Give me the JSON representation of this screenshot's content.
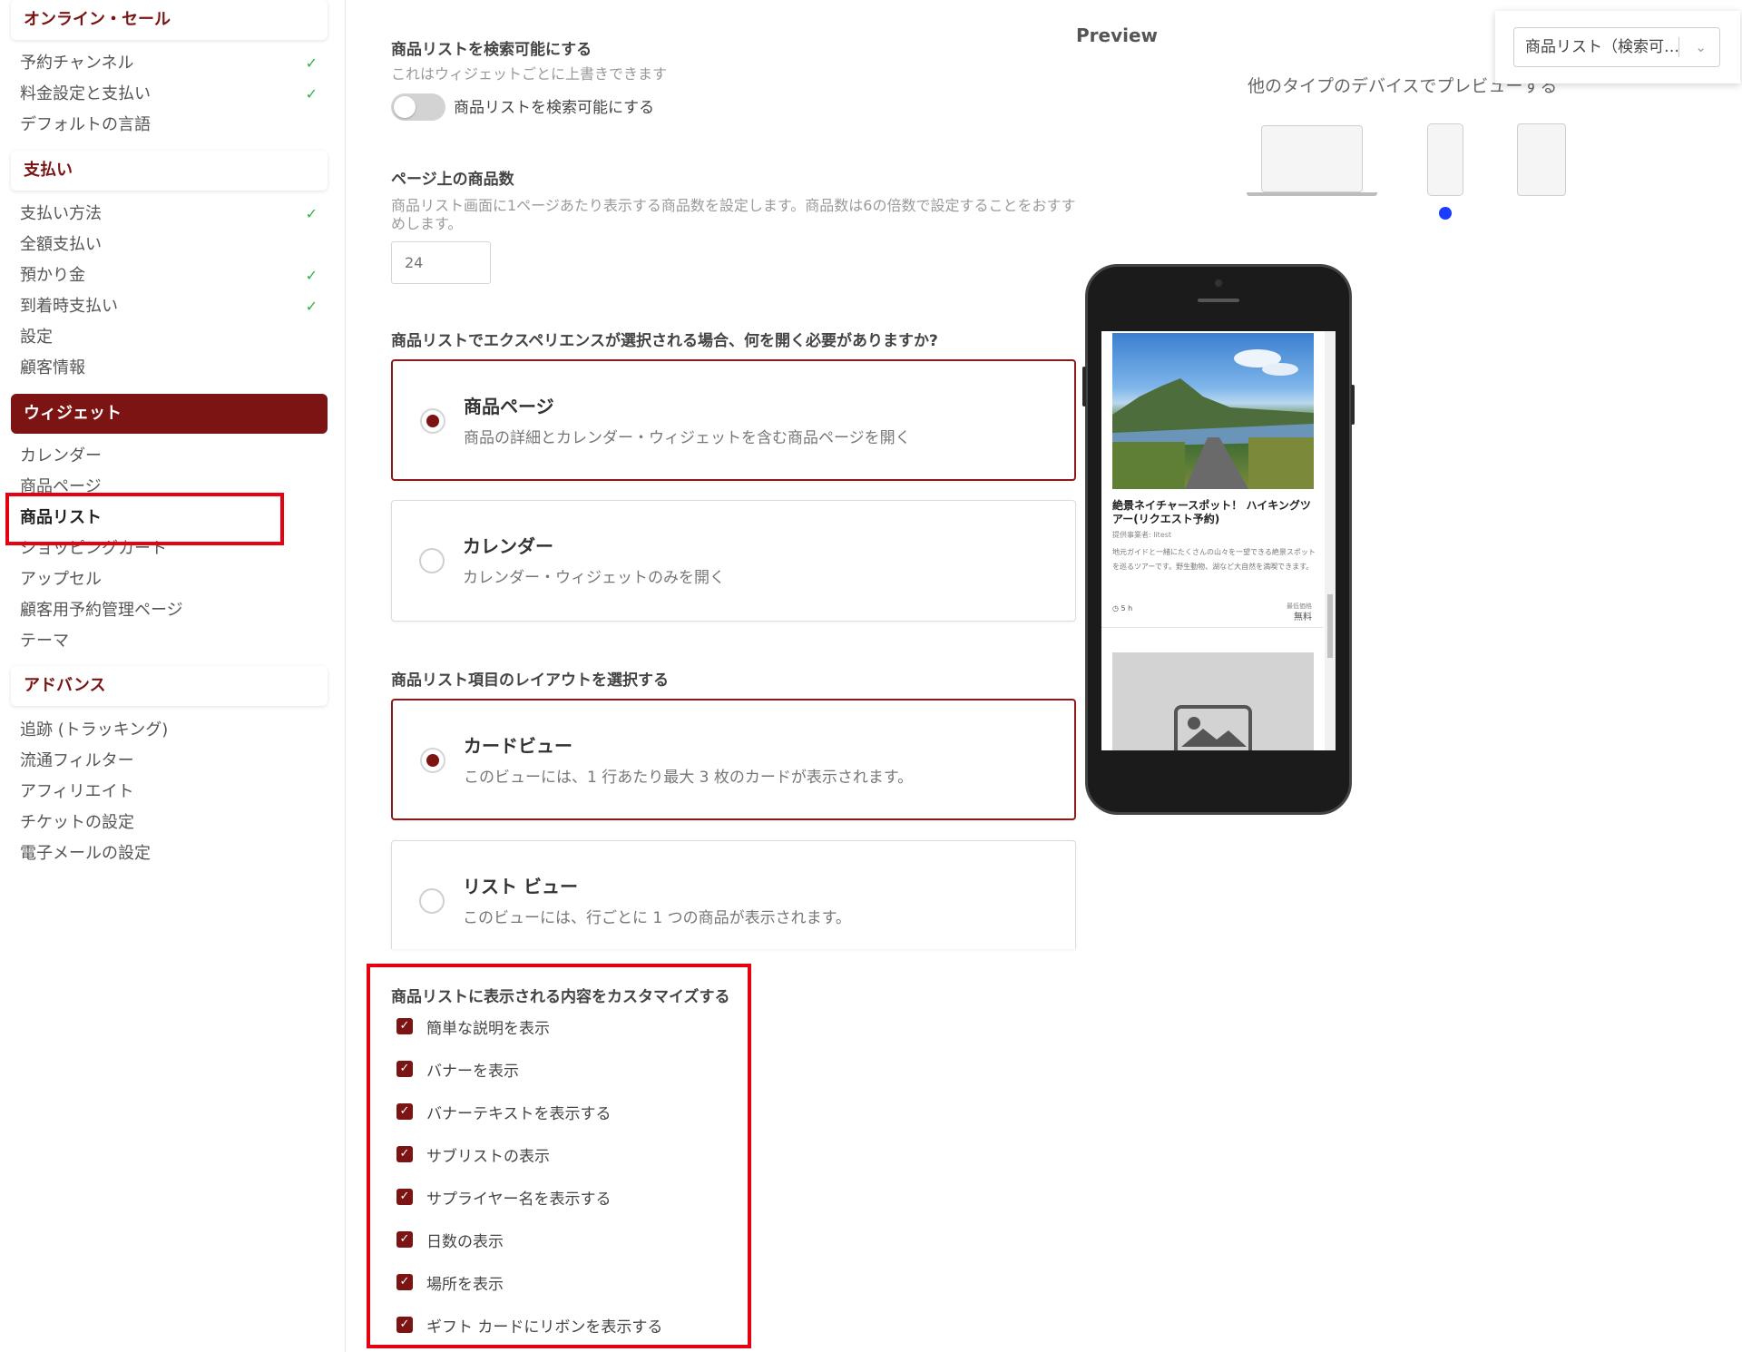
{
  "sidebar": {
    "online_sales": "オンライン・セール",
    "reservation_channel": "予約チャンネル",
    "fee_settings": "料金設定と支払い",
    "default_language": "デフォルトの言語",
    "payments": "支払い",
    "payment_methods": "支払い方法",
    "full_payment": "全額支払い",
    "deposit": "預かり金",
    "pay_on_arrival": "到着時支払い",
    "settings": "設定",
    "customer_info": "顧客情報",
    "widget": "ウィジェット",
    "calendar": "カレンダー",
    "product_page": "商品ページ",
    "product_list": "商品リスト",
    "shopping_cart": "ショッピングカート",
    "upsell": "アップセル",
    "customer_booking_page": "顧客用予約管理ページ",
    "theme": "テーマ",
    "advanced": "アドバンス",
    "tracking": "追跡 (トラッキング)",
    "flow_filter": "流通フィルター",
    "affiliate": "アフィリエイト",
    "ticket_settings": "チケットの設定",
    "email_settings": "電子メールの設定",
    "check": "✓"
  },
  "main": {
    "searchable_heading": "商品リストを検索可能にする",
    "searchable_hint": "これはウィジェットごとに上書きできます",
    "searchable_toggle_label": "商品リストを検索可能にする",
    "per_page_heading": "ページ上の商品数",
    "per_page_hint_1": "商品リスト画面に1ページあたり表示する商品数を設定します。商品数は6の倍数で設定することをおすす",
    "per_page_hint_2": "めします。",
    "per_page_value": "24",
    "open_heading": "商品リストでエクスペリエンスが選択される場合、何を開く必要がありますか?",
    "opt_product_title": "商品ページ",
    "opt_product_desc": "商品の詳細とカレンダー・ウィジェットを含む商品ページを開く",
    "opt_calendar_title": "カレンダー",
    "opt_calendar_desc": "カレンダー・ウィジェットのみを開く",
    "layout_heading": "商品リスト項目のレイアウトを選択する",
    "opt_card_title": "カードビュー",
    "opt_card_desc": "このビューには、1 行あたり最大 3 枚のカードが表示されます。",
    "opt_list_title": "リスト ビュー",
    "opt_list_desc": "このビューには、行ごとに 1 つの商品が表示されます。",
    "customize_heading": "商品リストに表示される内容をカスタマイズする",
    "cb_short_desc": "簡単な説明を表示",
    "cb_banner": "バナーを表示",
    "cb_banner_text": "バナーテキストを表示する",
    "cb_sublist": "サブリストの表示",
    "cb_supplier": "サプライヤー名を表示する",
    "cb_days": "日数の表示",
    "cb_location": "場所を表示",
    "cb_gift_ribbon": "ギフト カードにリボンを表示する",
    "cb_mark": "✓"
  },
  "preview": {
    "title": "Preview",
    "other_devices": "他のタイプのデバイスでプレビューする",
    "dropdown_value": "商品リスト（検索可…",
    "chevron": "⌄",
    "card_title": "絶景ネイチャースポット！ ハイキングツアー(リクエスト予約)",
    "card_supplier": "提供事業者: litest",
    "card_desc": "地元ガイドと一緒にたくさんの山々を一望できる絶景スポットを巡るツアーです。野生動物、湖など大自然を満喫できます。",
    "card_duration": "5 h",
    "card_price_label": "最低価格",
    "card_price": "無料"
  },
  "colors": {
    "brand": "#7d1414",
    "highlight": "#e60012",
    "check_green": "#2fb344",
    "device_dot": "#1a3cff"
  }
}
